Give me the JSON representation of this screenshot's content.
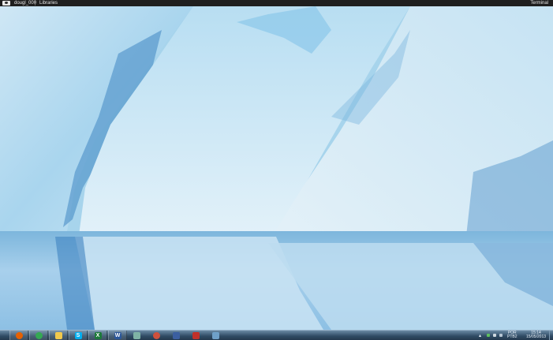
{
  "topbar": {
    "user_label": "dougl_000",
    "libraries_label": "Libraries",
    "terminal_label": "Terminal"
  },
  "taskbar": {
    "apps": [
      {
        "name": "firefox",
        "color": "#e66000"
      },
      {
        "name": "chrome",
        "color": "#34a853"
      },
      {
        "name": "file-explorer",
        "color": "#f2c94c"
      },
      {
        "name": "skype",
        "color": "#00aff0",
        "glyph": "S"
      },
      {
        "name": "excel",
        "color": "#1d7a3a",
        "glyph": "X"
      },
      {
        "name": "word",
        "color": "#2b579a",
        "glyph": "W"
      },
      {
        "name": "app-green",
        "color": "#7fb3a5"
      },
      {
        "name": "app-arc",
        "color": "#d0503c"
      },
      {
        "name": "app-blue",
        "color": "#3b5fa0"
      },
      {
        "name": "app-red",
        "color": "#c0302a"
      },
      {
        "name": "app-window",
        "color": "#6fa0c8"
      }
    ],
    "tray": {
      "language": "POR",
      "language_sub": "PTB2",
      "time": "15:14",
      "date": "15/05/2013"
    }
  }
}
